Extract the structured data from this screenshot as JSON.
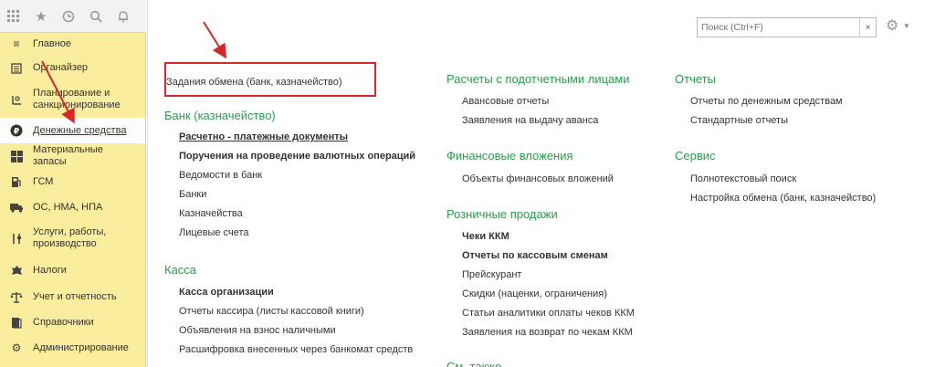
{
  "topbar": {
    "icons": [
      "apps-grid-icon",
      "star-icon",
      "history-icon",
      "search-icon",
      "bell-icon"
    ]
  },
  "sidebar": {
    "items": [
      {
        "label": "Главное",
        "icon": "menu-icon"
      },
      {
        "label": "Органайзер",
        "icon": "organizer-icon"
      },
      {
        "label": "Планирование и санкционирование",
        "icon": "planning-icon"
      },
      {
        "label": "Денежные средства",
        "icon": "ruble-icon"
      },
      {
        "label": "Материальные запасы",
        "icon": "stock-icon"
      },
      {
        "label": "ГСМ",
        "icon": "fuel-icon"
      },
      {
        "label": "ОС, НМА, НПА",
        "icon": "truck-icon"
      },
      {
        "label": "Услуги, работы, производство",
        "icon": "tools-icon"
      },
      {
        "label": "Налоги",
        "icon": "emblem-icon"
      },
      {
        "label": "Учет и отчетность",
        "icon": "scales-icon"
      },
      {
        "label": "Справочники",
        "icon": "books-icon"
      },
      {
        "label": "Администрирование",
        "icon": "gear-icon"
      }
    ]
  },
  "search": {
    "placeholder": "Поиск (Ctrl+F)",
    "clear": "×"
  },
  "col1": {
    "top_link": "Задания обмена (банк, казначейство)",
    "bank_title": "Банк (казначейство)",
    "bank_links": [
      "Расчетно - платежные документы",
      "Поручения на проведение валютных операций",
      "Ведомости в банк",
      "Банки",
      "Казначейства",
      "Лицевые счета"
    ],
    "cash_title": "Касса",
    "cash_links": [
      "Касса организации",
      "Отчеты кассира (листы кассовой книги)",
      "Объявления на взнос наличными",
      "Расшифровка внесенных через банкомат средств"
    ]
  },
  "col2": {
    "acc_title": "Расчеты с подотчетными лицами",
    "acc_links": [
      "Авансовые отчеты",
      "Заявления на выдачу аванса"
    ],
    "fin_title": "Финансовые вложения",
    "fin_links": [
      "Объекты финансовых вложений"
    ],
    "retail_title": "Розничные продажи",
    "retail_links": [
      "Чеки ККМ",
      "Отчеты по кассовым сменам",
      "Прейскурант",
      "Скидки (наценки, ограничения)",
      "Статьи аналитики оплаты чеков ККМ",
      "Заявления на возврат по чекам ККМ"
    ],
    "cut_text": "См. также"
  },
  "col3": {
    "rep_title": "Отчеты",
    "rep_links": [
      "Отчеты по денежным средствам",
      "Стандартные отчеты"
    ],
    "svc_title": "Сервис",
    "svc_links": [
      "Полнотекстовый поиск",
      "Настройка обмена (банк, казначейство)"
    ]
  },
  "colors": {
    "accent_green": "#2a9d4a",
    "sidebar_bg": "#fbed9e",
    "annotation_red": "#d8262b"
  }
}
